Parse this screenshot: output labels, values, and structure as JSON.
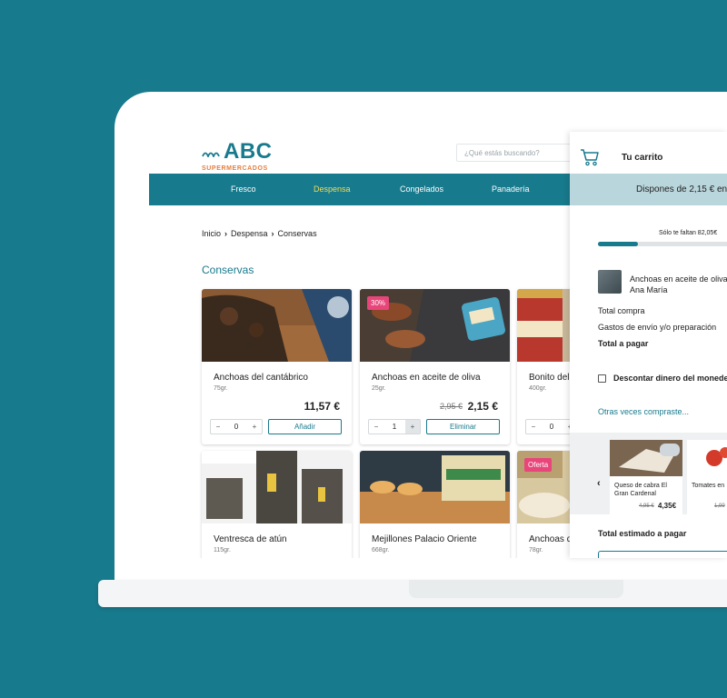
{
  "brand": {
    "name": "ABC",
    "tagline": "SUPERMERCADOS",
    "primary_color": "#187a8d",
    "accent_color": "#e67d3c"
  },
  "search": {
    "placeholder": "¿Qué estás buscando?"
  },
  "nav": {
    "items": [
      "Fresco",
      "Despensa",
      "Congelados",
      "Panadería"
    ],
    "active": "Despensa"
  },
  "breadcrumb": {
    "items": [
      "Inicio",
      "Despensa",
      "Conservas"
    ]
  },
  "section": {
    "title": "Conservas"
  },
  "products": [
    {
      "name": "Anchoas del cantábrico",
      "weight": "75gr.",
      "price": "11,57 €",
      "quantity": "0",
      "action": "Añadir"
    },
    {
      "name": "Anchoas en aceite de oliva",
      "weight": "25gr.",
      "badge": "30%",
      "old_price": "2,95 €",
      "price": "2,15 €",
      "quantity": "1",
      "action": "Eliminar"
    },
    {
      "name": "Bonito del",
      "weight": "400gr.",
      "quantity": "0"
    },
    {
      "name": "Ventresca de atún",
      "weight": "115gr."
    },
    {
      "name": "Mejillones Palacio Oriente",
      "weight": "668gr."
    },
    {
      "name": "Anchoas d",
      "weight": "78gr.",
      "badge": "Oferta"
    }
  ],
  "stepper": {
    "minus": "−",
    "plus": "+"
  },
  "cart": {
    "title": "Tu carrito",
    "icon": "cart-icon",
    "banner": "Dispones de 2,15 € en",
    "progress_label": "Sólo te faltan 82,05€",
    "progress": 0.3,
    "item": {
      "name_line1": "Anchoas en aceite de oliva",
      "name_line2": "Ana María"
    },
    "rows": {
      "total_compra": "Total compra",
      "gastos": "Gastos de envío y/o preparación",
      "total_pagar": "Total a pagar"
    },
    "wallet_checkbox": "Descontar dinero del monedero",
    "link": "Otras veces compraste...",
    "recommendations": [
      {
        "name": "Queso de cabra El Gran Cardenal",
        "old_price": "4,95 €",
        "price": "4,35€"
      },
      {
        "name": "Tomates en",
        "old_price": "1,99"
      }
    ],
    "total_estimated": "Total estimado a pagar"
  }
}
